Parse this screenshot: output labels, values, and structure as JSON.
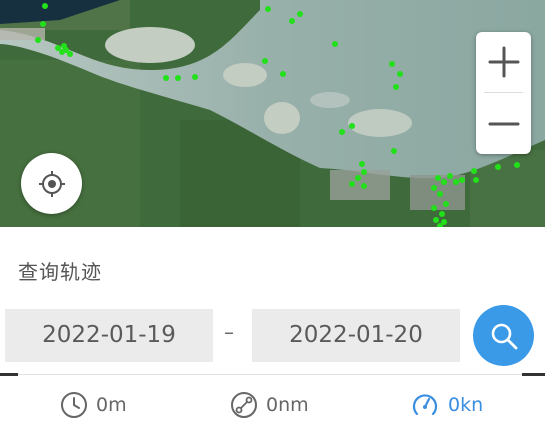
{
  "map": {
    "zoom_in_label": "+",
    "zoom_out_label": "−",
    "track_color": "#22e01a",
    "water_color": "#9db3ad",
    "land_color": "#3c6339"
  },
  "query": {
    "title": "查询轨迹",
    "start_date": "2022-01-19",
    "separator": "–",
    "end_date": "2022-01-20"
  },
  "stats": {
    "duration": "0m",
    "distance": "0nm",
    "speed": "0kn"
  },
  "colors": {
    "accent": "#3a9ae8",
    "speed_text": "#3a8ee0"
  }
}
